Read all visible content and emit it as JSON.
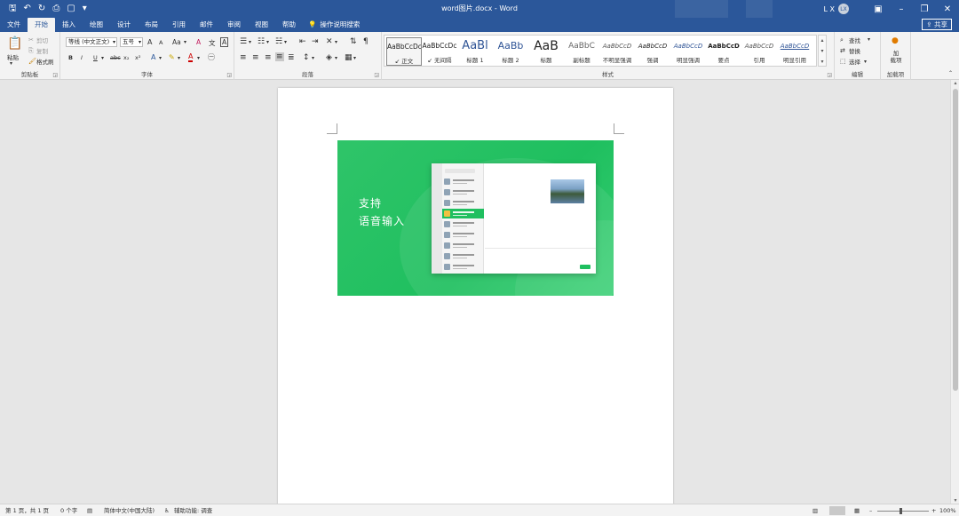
{
  "app": {
    "title": "word图片.docx - Word",
    "user": "L X",
    "avatar": "LX",
    "share": "共享"
  },
  "qat": {
    "save_icon": "🖫",
    "undo_icon": "↶",
    "redo_icon": "↻",
    "print_icon": "⎙",
    "touch_icon": "▢",
    "more_icon": "▾"
  },
  "tabs": [
    "文件",
    "开始",
    "插入",
    "绘图",
    "设计",
    "布局",
    "引用",
    "邮件",
    "审阅",
    "视图",
    "帮助"
  ],
  "active_tab": "开始",
  "tell_me": "操作说明搜索",
  "ribbon": {
    "clipboard": {
      "label": "剪贴板",
      "paste": "粘贴",
      "cut": "剪切",
      "copy": "复制",
      "format_painter": "格式刷"
    },
    "font": {
      "label": "字体",
      "font_name": "等线 (中文正文)",
      "font_size": "五号",
      "grow": "A",
      "shrink": "A",
      "case": "Aa",
      "bold": "B",
      "italic": "I",
      "underline": "U",
      "strike": "abc",
      "subscript": "x₂",
      "superscript": "x²",
      "color_a": "A",
      "clear": "A",
      "phonetic": "文",
      "border": "A"
    },
    "paragraph": {
      "label": "段落"
    },
    "styles": {
      "label": "样式",
      "items": [
        {
          "preview": "AaBbCcDc",
          "name": "↙ 正文"
        },
        {
          "preview": "AaBbCcDc",
          "name": "↙ 无间隔"
        },
        {
          "preview": "AaBl",
          "name": "标题 1"
        },
        {
          "preview": "AaBb",
          "name": "标题 2"
        },
        {
          "preview": "AaB",
          "name": "标题"
        },
        {
          "preview": "AaBbC",
          "name": "副标题"
        },
        {
          "preview": "AaBbCcD",
          "name": "不明显强调"
        },
        {
          "preview": "AaBbCcD",
          "name": "强调"
        },
        {
          "preview": "AaBbCcD",
          "name": "明显强调"
        },
        {
          "preview": "AaBbCcD",
          "name": "要点"
        },
        {
          "preview": "AaBbCcD",
          "name": "引用"
        },
        {
          "preview": "AaBbCcD",
          "name": "明显引用"
        }
      ]
    },
    "editing": {
      "label": "编辑",
      "find": "查找",
      "replace": "替换",
      "select": "选择"
    },
    "addins": {
      "label": "加载项",
      "button": "加\n载项"
    }
  },
  "document": {
    "image_text_1": "支持",
    "image_text_2": "语音输入"
  },
  "status": {
    "page": "第 1 页，共 1 页",
    "words": "0 个字",
    "language": "简体中文(中国大陆)",
    "accessibility": "辅助功能: 调查",
    "zoom": "100%"
  }
}
